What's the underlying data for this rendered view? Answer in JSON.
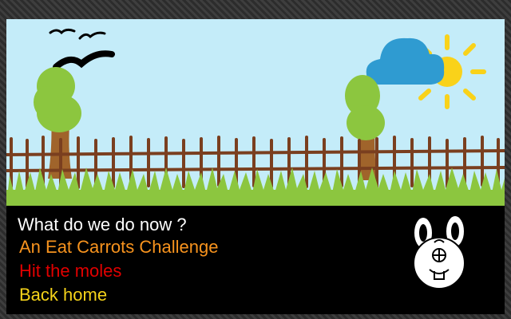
{
  "dialog": {
    "question": "What do we do now ?",
    "options": [
      {
        "label": "An Eat Carrots Challenge",
        "color": "#f7931e"
      },
      {
        "label": "Hit the moles",
        "color": "#e10000"
      },
      {
        "label": "Back home",
        "color": "#f5d31a"
      }
    ]
  },
  "colors": {
    "sky": "#c4ecf9",
    "grass": "#8cc63f",
    "fence": "#7a3f1f",
    "tree_top": "#8cc63f",
    "trunk": "#a0642b",
    "cloud": "#2f9bd1",
    "sun": "#f9d21a",
    "dialog_bg": "#000000"
  },
  "icons": [
    "birds-icon",
    "sun-icon",
    "cloud-icon",
    "tree-icon",
    "fence-icon",
    "grass-icon",
    "rabbit-portrait-icon"
  ]
}
